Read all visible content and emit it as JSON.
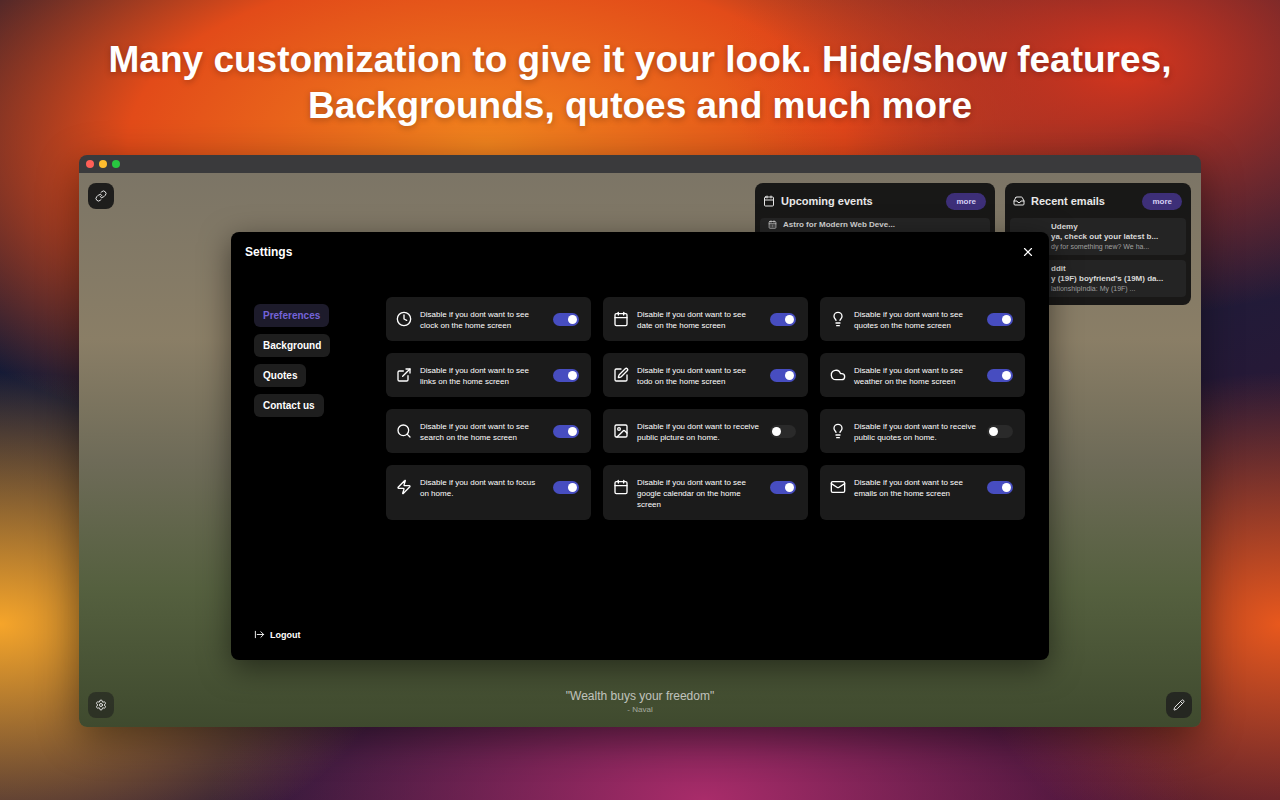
{
  "headline": [
    "Many customization to give it your look. Hide/show features,",
    "Backgrounds, qutoes and much more"
  ],
  "widgets": {
    "events": {
      "title": "Upcoming events",
      "more": "more",
      "items": [
        {
          "title": "Astro for Modern Web Deve..."
        }
      ]
    },
    "emails": {
      "title": "Recent emails",
      "more": "more",
      "items": [
        {
          "sender": "Udemy",
          "subject": "ya, check out your latest b...",
          "preview": "dy for something new? We ha..."
        },
        {
          "sender": "ddit",
          "subject": "y (19F) boyfriend's (19M) da...",
          "preview": "lationshipIndia: My (19F) ..."
        }
      ]
    }
  },
  "settings": {
    "title": "Settings",
    "nav": [
      {
        "label": "Preferences",
        "selected": true
      },
      {
        "label": "Background",
        "selected": false
      },
      {
        "label": "Quotes",
        "selected": false
      },
      {
        "label": "Contact us",
        "selected": false
      }
    ],
    "logout": "Logout",
    "toggles": [
      {
        "label": "Disable if you dont want to see clock on the home screen",
        "on": true
      },
      {
        "label": "Disable if you dont want to see date on the home screen",
        "on": true
      },
      {
        "label": "Disable if you dont want to see quotes on the home screen",
        "on": true
      },
      {
        "label": "Disable if you dont want to see links on the home screen",
        "on": true
      },
      {
        "label": "Disable if you dont want to see todo on the home screen",
        "on": true
      },
      {
        "label": "Disable if you dont want to see weather on the home screen",
        "on": true
      },
      {
        "label": "Disable if you dont want to see search on the home screen",
        "on": true
      },
      {
        "label": "Disable if you dont want to receive public picture on home.",
        "on": false
      },
      {
        "label": "Disable if you dont want to receive public quotes on home.",
        "on": false
      },
      {
        "label": "Disable if you dont want to focus on home.",
        "on": true
      },
      {
        "label": "Disable if you dont want to see google calendar on the home screen",
        "on": true
      },
      {
        "label": "Disable if you dont want to see emails on the home screen",
        "on": true
      }
    ]
  },
  "quote": {
    "text": "\"Wealth buys your freedom\"",
    "author": "- Naval"
  }
}
